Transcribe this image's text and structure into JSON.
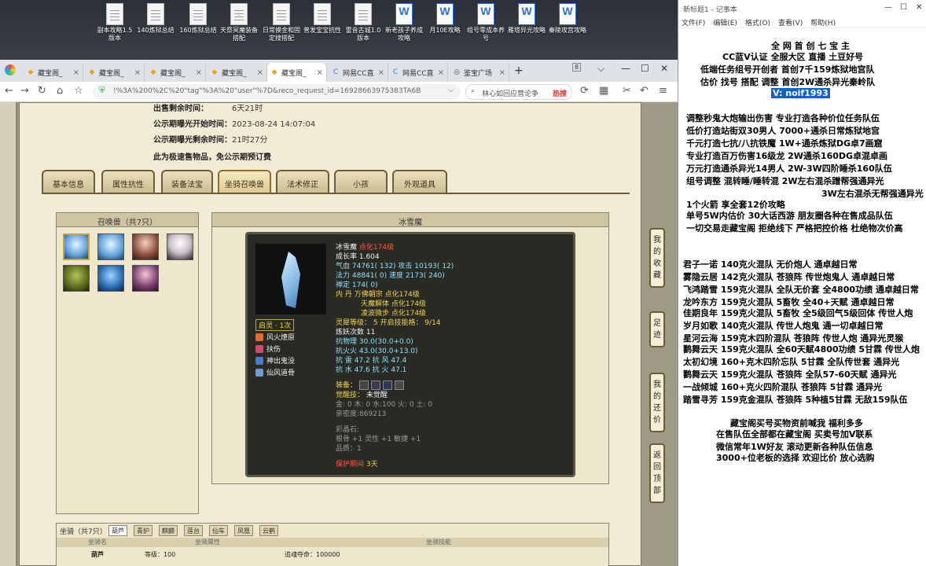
{
  "desktop": {
    "icons": [
      {
        "label": "副本攻略1.5版本",
        "type": "doc"
      },
      {
        "label": "140炼狱总结",
        "type": "doc"
      },
      {
        "label": "160炼狱总结",
        "type": "doc"
      },
      {
        "label": "天祭冥魔装备搭配",
        "type": "doc"
      },
      {
        "label": "日常摸金和固定搜搭配",
        "type": "doc"
      },
      {
        "label": "普发宝宝抗性",
        "type": "doc"
      },
      {
        "label": "雷音古城1.0版本",
        "type": "doc"
      },
      {
        "label": "新老孩子养成攻略",
        "type": "word"
      },
      {
        "label": "月10E攻略",
        "type": "word"
      },
      {
        "label": "组号零成本养号",
        "type": "word"
      },
      {
        "label": "雁塔异光攻略",
        "type": "word"
      },
      {
        "label": "秦陵攻宫攻略",
        "type": "word"
      }
    ]
  },
  "browser": {
    "tabs": [
      {
        "label": "藏宝阁_",
        "icon": "cbg"
      },
      {
        "label": "藏宝阁_",
        "icon": "cbg"
      },
      {
        "label": "藏宝阁_",
        "icon": "cbg"
      },
      {
        "label": "藏宝阁_",
        "icon": "cbg"
      },
      {
        "label": "藏宝阁_",
        "icon": "cbg",
        "active": true
      },
      {
        "label": "网易CC直",
        "icon": "cc"
      },
      {
        "label": "网易CC直",
        "icon": "cc"
      },
      {
        "label": "鉴宝广场",
        "icon": "globe"
      }
    ],
    "new_tab": "+",
    "tab_count": "8",
    "url": "!%3A%200%2C%20\"tag\"%3A%20\"user\"%7D&reco_request_id=16928663975383TA6B",
    "search_text": "林心如回应营论争",
    "hot_label": "热搜"
  },
  "listing": {
    "time_left_label": "出售剩余时间：",
    "time_left_value": "6天21时",
    "publicity_start_label": "公示期曝光开始时间：",
    "publicity_start_value": "2023-08-24 14:07:04",
    "publicity_left_label": "公示期曝光剩余时间：",
    "publicity_left_value": "21时27分",
    "notice": "此为极速售物品，免公示期预订费"
  },
  "page_tabs": [
    "基本信息",
    "属性抗性",
    "装备法宝",
    "坐骑召唤兽",
    "法术修正",
    "小孩",
    "外观道具"
  ],
  "summon_panel": {
    "title": "召唤兽（共7只）"
  },
  "pet": {
    "panel_title": "冰雪魔",
    "name": "冰雪魔",
    "name_suffix": "点化174级",
    "growth": "成长率 1.604",
    "hp": "气血 74761( 132) 攻击 10193( 12)",
    "mp": "法力 48841( 0) 速度 2173( 240)",
    "loyalty": "禅定 174( 0)",
    "skills_line1": "内  丹  万佛朝宗 点化174级",
    "skills_line2": "天魔解体 点化174级",
    "skills_line3": "凌波微步 点化174级",
    "spirit_level": "灵犀等级：  5 开启技能格：  9/14",
    "refine_count": "炼妖次数 11",
    "resist_phys": "抗物理  30.0(30.0+0.0)",
    "resist_fire": "抗火火  43.0(30.0+13.0)",
    "resist_thunder_wind": "抗  雷  47.2 抗  风  47.4",
    "resist_water_fire": "抗  水  47.6 抗  火  47.1",
    "spirit_badge": "启灵 · 1次",
    "pet_skills": [
      "风火燎原",
      "扶伤",
      "神出鬼没",
      "仙风道骨"
    ],
    "equip_label": "装备：",
    "awaken_label": "觉醒技：",
    "awaken_value": "未觉醒",
    "elements": "金: 0 木: 0 水:100 火: 0 土: 0",
    "affinity": "亲密度:869213",
    "gem_label": "彩晶石:",
    "gem_stats": "根骨 +1 灵性 +1 敏捷 +1",
    "gem_quality": "品质：1",
    "protect_label": "保护期间",
    "protect_value": "3天"
  },
  "mount_panel": {
    "title": "坐骑（共7只）",
    "tabs": [
      "葫芦",
      "青护",
      "麒麟",
      "莲台",
      "仙车",
      "凤凰",
      "云鹤"
    ],
    "col1": "坐骑名",
    "col2": "坐骑属性",
    "col3": "坐骑技能",
    "row_name": "葫芦",
    "row_level": "等级：100",
    "row_extra": "追魂夺命：100000"
  },
  "side_buttons": [
    "我的收藏",
    "足迹",
    "我的还价",
    "返回顶部"
  ],
  "notepad": {
    "title": "新标题1 - 记事本",
    "menu": [
      "文件(F)",
      "编辑(E)",
      "格式(O)",
      "查看(V)",
      "帮助(H)"
    ],
    "lines": [
      {
        "text": "全 网 首 创 七 宝 主",
        "indent": 118
      },
      {
        "text": "CC蓝V认证 全服大区 直播 土豆好号",
        "indent": 56
      },
      {
        "text": "低端任务组号开创者            首创7千159炼狱地宫队",
        "indent": 28
      },
      {
        "text": "估价 找号 搭配 调整             首创2W通杀异光秦岭队",
        "indent": 28
      },
      {
        "text": "V:  noif1993",
        "indent": 118,
        "highlight": true
      },
      {
        "text": "",
        "indent": 0
      },
      {
        "text": "调整秒鬼大炮输出伤害         专业打造各种价位任务队伍",
        "indent": 10
      },
      {
        "text": "低价打造站街双30男人              7000+通杀日常炼狱地宫",
        "indent": 10
      },
      {
        "text": "千元打造七抗/八抗铁魔           1W+通杀炼狱DG卓7画窟",
        "indent": 10
      },
      {
        "text": "专业打造百万伤害16级龙          2W通杀160DG卓混卓画",
        "indent": 10
      },
      {
        "text": "万元打造通杀异光14男人         2W-3W四阶睡杀160队伍",
        "indent": 10
      },
      {
        "text": "组号调整 混转睡/睡转混          2W左右混杀蹭帮强通异光",
        "indent": 10
      },
      {
        "text": "3W左右混杀无帮强通异光",
        "indent": 182
      },
      {
        "text": "1个火箭 享全套12价攻略",
        "indent": 10
      },
      {
        "text": "单号5W内估价 30大话西游        朋友圈各种在售成品队伍",
        "indent": 10
      },
      {
        "text": "一切交易走藏宝阁 拒绝线下      严格把控价格 杜绝物次价高",
        "indent": 10
      },
      {
        "text": "",
        "indent": 0
      },
      {
        "text": "",
        "indent": 0
      },
      {
        "text": "君子一诺 140克火混队 无价炮人 通卓越日常",
        "indent": 6
      },
      {
        "text": "雾隐云居 142克火混队 苍狼阵 传世炮鬼人 通卓越日常",
        "indent": 6
      },
      {
        "text": "飞鸿踏雪 159克火混队 全队无价套 全4800功绩 通卓越日常",
        "indent": 6
      },
      {
        "text": "龙吟东方 159克火混队 5畜牧 全40+天赋 通卓越日常",
        "indent": 6
      },
      {
        "text": "佳期良年 159克火混队 5畜牧 全5级回气5级回体 传世人炮",
        "indent": 6
      },
      {
        "text": "岁月如歌 140克火混队 传世人炮鬼 通一切卓越日常",
        "indent": 6
      },
      {
        "text": "星河云海 159克木四阶混队 苍狼阵 传世人炮 通异光灵猴",
        "indent": 6
      },
      {
        "text": "鹳舞云天 159克火混队 全60天赋4800功绩 5甘霖 传世人炮",
        "indent": 6
      },
      {
        "text": "太初幻境 160+克木四阶忘队 5甘霖 全队传世套 通异光",
        "indent": 6
      },
      {
        "text": "鹳舞云天 159克火混队 苍狼阵 全队57-60天赋 通异光",
        "indent": 6
      },
      {
        "text": "一战倾城 160+克火四阶混队 苍狼阵 5甘霖 通异光",
        "indent": 6
      },
      {
        "text": "踏雪寻芳 159克金混队 苍狼阵 5种植5甘霖 无敌159队伍",
        "indent": 6
      },
      {
        "text": "",
        "indent": 0
      },
      {
        "text": "藏宝阁买号买物资前喊我 福利多多",
        "indent": 66
      },
      {
        "text": "在售队伍全部都在藏宝阁 买卖号加V联系",
        "indent": 48
      },
      {
        "text": "微信常年1W好友 滚动更新各种队伍信息",
        "indent": 48
      },
      {
        "text": "3000+位老板的选择 欢迎比价 放心选购",
        "indent": 48
      }
    ]
  }
}
